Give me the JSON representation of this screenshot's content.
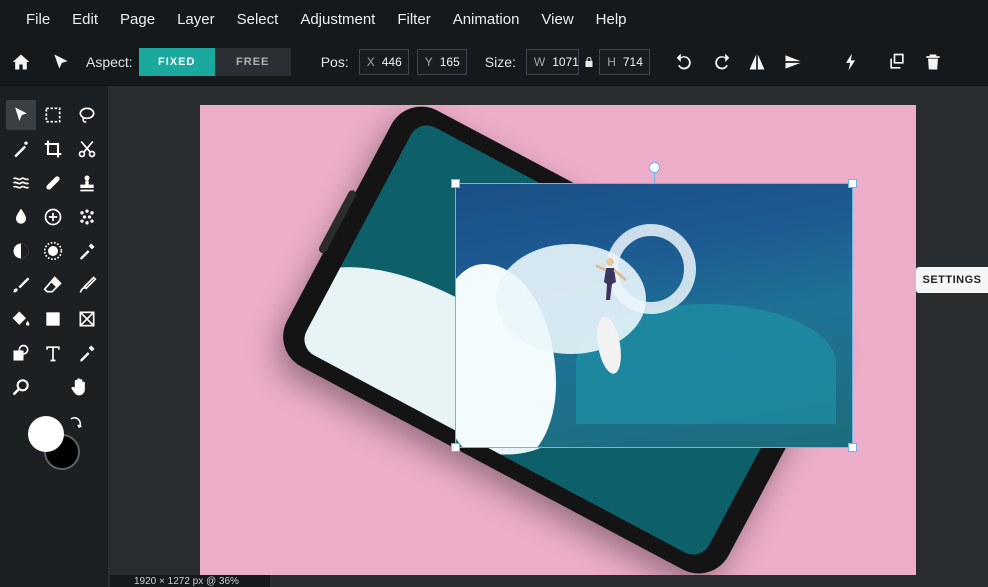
{
  "menubar": {
    "items": [
      "File",
      "Edit",
      "Page",
      "Layer",
      "Select",
      "Adjustment",
      "Filter",
      "Animation",
      "View",
      "Help"
    ]
  },
  "toolbar": {
    "aspect_label": "Aspect:",
    "aspect_fixed": "FIXED",
    "aspect_free": "FREE",
    "pos_label": "Pos:",
    "x_key": "X",
    "x_value": "446",
    "y_key": "Y",
    "y_value": "165",
    "size_label": "Size:",
    "w_key": "W",
    "w_value": "1071",
    "h_key": "H",
    "h_value": "714"
  },
  "side_panel": {
    "settings_label": "SETTINGS"
  },
  "status": {
    "text": "1920 × 1272 px @ 36%"
  },
  "colors": {
    "accent": "#1ba89f",
    "canvas_bg": "#ecadc8",
    "primary_color": "#ffffff",
    "secondary_color": "#000000"
  }
}
